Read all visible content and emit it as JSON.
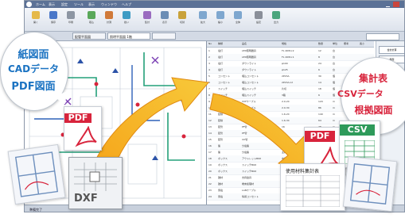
{
  "app": {
    "menu": [
      "ホーム",
      "表示",
      "設定",
      "ツール",
      "表示",
      "ウィンドウ",
      "ヘルプ"
    ],
    "ribbon_buttons": [
      "開く",
      "保存",
      "印刷",
      "取込",
      "計測",
      "拾い",
      "集計",
      "表示",
      "切替",
      "拡大",
      "縮小",
      "全体",
      "設定",
      "出力"
    ],
    "doc_tabs": [
      "配管平面図",
      "照明平面図 1階",
      ""
    ],
    "search_value": "",
    "status": "準備完了"
  },
  "table": {
    "headers": [
      "No",
      "種類",
      "品名",
      "規格",
      "数量",
      "単位",
      "備考",
      "長さ"
    ],
    "rows": [
      [
        "1",
        "電灯",
        "LED照明器具",
        "FL 40W×2",
        "12",
        "台"
      ],
      [
        "2",
        "電灯",
        "LED照明器具",
        "FL 20W×1",
        "8",
        "台"
      ],
      [
        "3",
        "電灯",
        "ダウンライト",
        "φ100",
        "24",
        "台"
      ],
      [
        "4",
        "電灯",
        "ダウンライト",
        "φ125",
        "6",
        "台"
      ],
      [
        "5",
        "コンセント",
        "埋込コンセント",
        "2P15A",
        "30",
        "個"
      ],
      [
        "6",
        "コンセント",
        "埋込コンセント",
        "2P15A×2",
        "14",
        "個"
      ],
      [
        "7",
        "スイッチ",
        "埋込スイッチ",
        "片切",
        "18",
        "個"
      ],
      [
        "8",
        "スイッチ",
        "埋込スイッチ",
        "3路",
        "6",
        "個"
      ],
      [
        "9",
        "配線",
        "VVFケーブル",
        "2.0-2C",
        "120",
        "m"
      ],
      [
        "10",
        "配線",
        "VVFケーブル",
        "2.0-3C",
        "86",
        "m"
      ],
      [
        "11",
        "配線",
        "VVFケーブル",
        "1.6-2C",
        "140",
        "m"
      ],
      [
        "12",
        "配線",
        "VVFケーブル",
        "1.6-3C",
        "64",
        "m"
      ],
      [
        "13",
        "配管",
        "PF管",
        "16",
        "48",
        "m"
      ],
      [
        "14",
        "配管",
        "PF管",
        "22",
        "36",
        "m"
      ],
      [
        "15",
        "配管",
        "CD管",
        "16",
        "52",
        "m"
      ],
      [
        "16",
        "盤",
        "分電盤",
        "主幹50A",
        "1",
        "面"
      ],
      [
        "17",
        "盤",
        "分電盤",
        "主幹30A",
        "2",
        "面"
      ],
      [
        "18",
        "ボックス",
        "アウトレットBOX",
        "中四角",
        "40",
        "個"
      ],
      [
        "19",
        "ボックス",
        "スイッチBOX",
        "1個用",
        "24",
        "個"
      ],
      [
        "20",
        "ボックス",
        "スイッチBOX",
        "2個用",
        "8",
        "個"
      ],
      [
        "21",
        "雑材",
        "支持金具",
        "",
        "1",
        "式"
      ],
      [
        "22",
        "雑材",
        "端末処理材",
        "",
        "1",
        "式"
      ],
      [
        "23",
        "弱電",
        "LANケーブル",
        "Cat6",
        "90",
        "m"
      ],
      [
        "24",
        "弱電",
        "情報コンセント",
        "RJ45",
        "10",
        "個"
      ]
    ]
  },
  "side_panel": {
    "btn1": "合計計算",
    "btn2": "保存"
  },
  "callouts": {
    "left_lines": [
      "紙図面",
      "CADデータ",
      "PDF図面"
    ],
    "right_lines": [
      "集計表",
      "CSVデータ",
      "根拠図面"
    ]
  },
  "file_labels": {
    "pdf_left": "PDF",
    "dxf": "DXF",
    "pdf_right": "PDF",
    "csv": "CSV"
  },
  "report": {
    "title": "使用材料集計表"
  }
}
